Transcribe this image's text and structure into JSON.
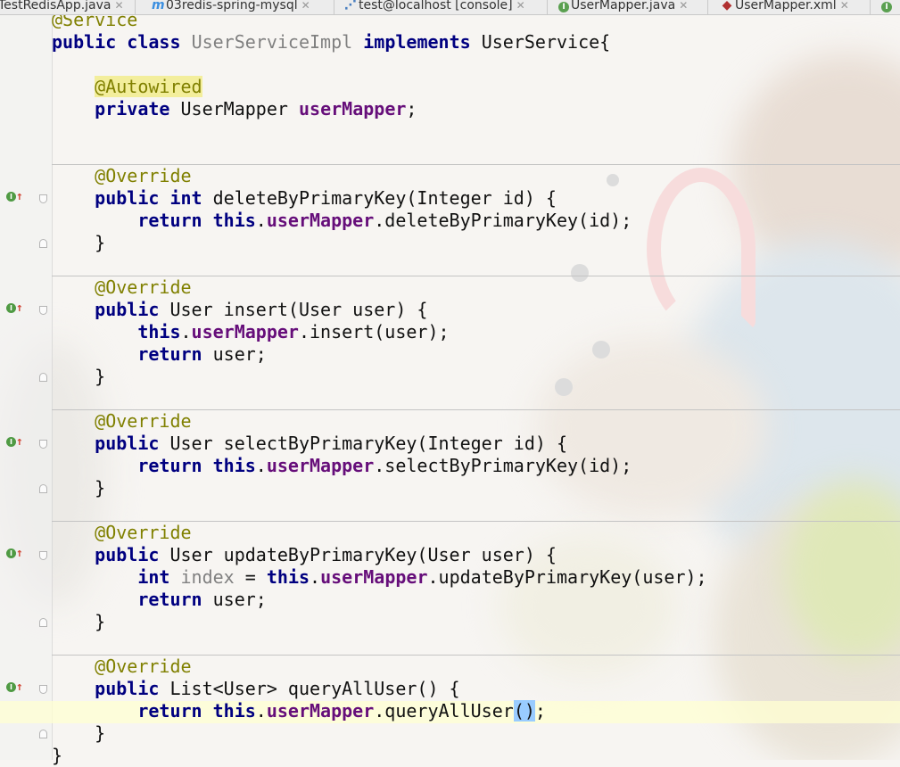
{
  "tabs": [
    {
      "label": "TestRedisApp.java",
      "icon": "java-class-icon"
    },
    {
      "label": "03redis-spring-mysql",
      "icon": "maven-module-icon"
    },
    {
      "label": "test@localhost [console]",
      "icon": "database-console-icon"
    },
    {
      "label": "UserMapper.java",
      "icon": "interface-icon"
    },
    {
      "label": "UserMapper.xml",
      "icon": "xml-file-icon"
    }
  ],
  "code": {
    "l1_ann": "@Service",
    "l2_public": "public",
    "l2_class": "class",
    "l2_name": "UserServiceImpl",
    "l2_implements": "implements",
    "l2_rest": "UserService{",
    "autowired": "@Autowired",
    "private": "private",
    "mapper_type": "UserMapper",
    "mapper_field": "userMapper",
    "semi": ";",
    "override": "@Override",
    "public": "public",
    "int": "int",
    "return": "return",
    "this": "this",
    "close_brace": "}",
    "m1_sig": "deleteByPrimaryKey(Integer id) {",
    "m1_call": ".deleteByPrimaryKey(id);",
    "m2_sig": "User insert(User user) {",
    "m2_call": ".insert(user);",
    "m2_ret": "user;",
    "m3_sig": "User selectByPrimaryKey(Integer id) {",
    "m3_call": ".selectByPrimaryKey(id);",
    "m4_sig": "User updateByPrimaryKey(User user) {",
    "m4_index": "index",
    "m4_eq": "=",
    "m4_call": ".updateByPrimaryKey(user);",
    "m4_ret": "user;",
    "m5_sig": "List<User> queryAllUser() {",
    "m5_call": ".queryAllUser",
    "m5_paren": "()",
    "m5_semi": ";",
    "final_brace": "}"
  },
  "gutter": {
    "implements_marker": "I",
    "override_arrow": "↑"
  }
}
